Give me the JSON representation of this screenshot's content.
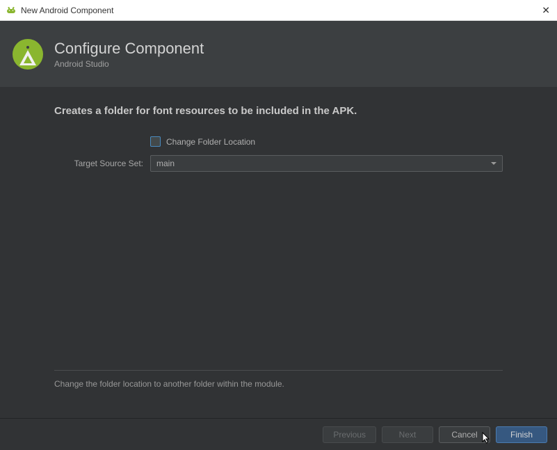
{
  "window": {
    "title": "New Android Component"
  },
  "header": {
    "title": "Configure Component",
    "subtitle": "Android Studio"
  },
  "main": {
    "heading": "Creates a folder for font resources to be included in the APK.",
    "checkbox_label": "Change Folder Location",
    "checkbox_checked": false,
    "target_source_label": "Target Source Set:",
    "target_source_value": "main",
    "hint": "Change the folder location to another folder within the module."
  },
  "footer": {
    "previous": "Previous",
    "next": "Next",
    "cancel": "Cancel",
    "finish": "Finish"
  }
}
